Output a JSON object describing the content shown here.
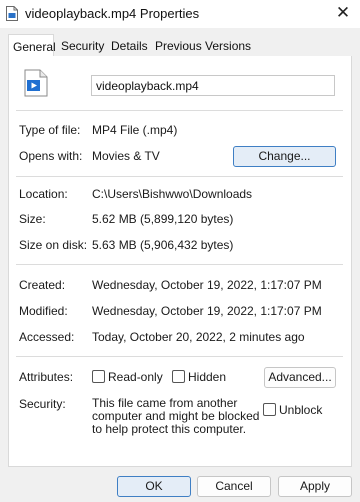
{
  "window": {
    "title": "videoplayback.mp4 Properties",
    "close_glyph": "✕"
  },
  "tabs": [
    {
      "label": "General",
      "active": true
    },
    {
      "label": "Security",
      "active": false
    },
    {
      "label": "Details",
      "active": false
    },
    {
      "label": "Previous Versions",
      "active": false
    }
  ],
  "file": {
    "name": "videoplayback.mp4"
  },
  "type_row": {
    "label": "Type of file:",
    "value": "MP4 File (.mp4)"
  },
  "opens_row": {
    "label": "Opens with:",
    "value": "Movies & TV",
    "button": "Change..."
  },
  "location_row": {
    "label": "Location:",
    "value": "C:\\Users\\Bishwwo\\Downloads"
  },
  "size_row": {
    "label": "Size:",
    "value": "5.62 MB (5,899,120 bytes)"
  },
  "size_disk_row": {
    "label": "Size on disk:",
    "value": "5.63 MB (5,906,432 bytes)"
  },
  "created_row": {
    "label": "Created:",
    "value": "Wednesday, October 19, 2022, 1:17:07 PM"
  },
  "modified_row": {
    "label": "Modified:",
    "value": "Wednesday, October 19, 2022, 1:17:07 PM"
  },
  "accessed_row": {
    "label": "Accessed:",
    "value": "Today, October 20, 2022, 2 minutes ago"
  },
  "attributes": {
    "label": "Attributes:",
    "readonly": "Read-only",
    "hidden": "Hidden",
    "advanced": "Advanced..."
  },
  "security": {
    "label": "Security:",
    "text": "This file came from another computer and might be blocked to help protect this computer.",
    "unblock": "Unblock"
  },
  "footer": {
    "ok": "OK",
    "cancel": "Cancel",
    "apply": "Apply"
  },
  "colors": {
    "accent": "#3f7fc4",
    "icon_blue": "#1f6fd1"
  }
}
